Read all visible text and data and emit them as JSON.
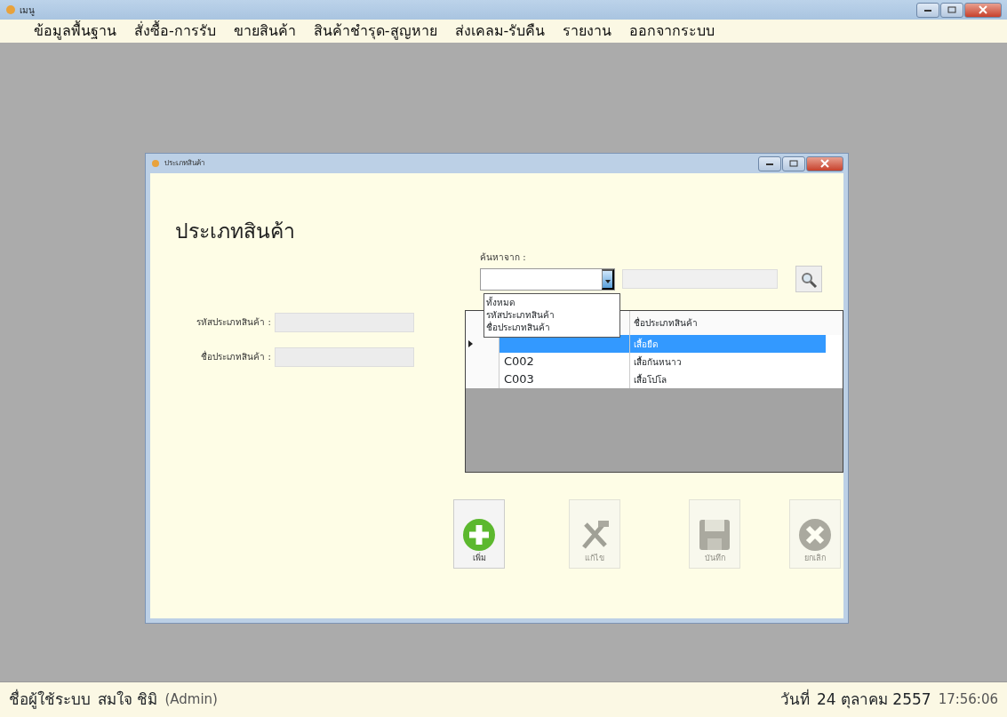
{
  "window": {
    "title": "เมนู"
  },
  "menu": [
    {
      "label": "ข้อมูลพื้นฐาน"
    },
    {
      "label": "สั่งซื้อ-การรับ"
    },
    {
      "label": "ขายสินค้า"
    },
    {
      "label": "สินค้าชำรุด-สูญหาย"
    },
    {
      "label": "ส่งเคลม-รับคืน"
    },
    {
      "label": "รายงาน"
    },
    {
      "label": "ออกจากระบบ"
    }
  ],
  "child_window": {
    "title": "ประเภทสินค้า",
    "heading": "ประเภทสินค้า",
    "fields": [
      {
        "label": "รหัสประเภทสินค้า :"
      },
      {
        "label": "ชื่อประเภทสินค้า :"
      }
    ],
    "search": {
      "label": "ค้นหาจาก :",
      "expanded": true,
      "options": [
        {
          "label": "ทั้งหมด"
        },
        {
          "label": "รหัสประเภทสินค้า"
        },
        {
          "label": "ชื่อประเภทสินค้า"
        }
      ]
    },
    "grid": {
      "column_2": "ชื่อประเภทสินค้า",
      "rows": [
        {
          "name": "เสื้อยืด",
          "selected": true
        },
        {
          "code": "C002",
          "name": "เสื้อกันหนาว",
          "selected": false
        },
        {
          "code": "C003",
          "name": "เสื้อโปโล",
          "selected": false
        }
      ]
    },
    "buttons": [
      {
        "label": "เพิ่ม",
        "kind": "add",
        "disabled": false
      },
      {
        "label": "แก้ไข",
        "kind": "edit",
        "disabled": true
      },
      {
        "label": "บันทึก",
        "kind": "save",
        "disabled": true
      },
      {
        "label": "ยกเลิก",
        "kind": "cancel",
        "disabled": true
      }
    ]
  },
  "status_bar": {
    "user_label": "ชื่อผู้ใช้ระบบ",
    "user_name": "สมใจ ชิมิ",
    "role": "(Admin)",
    "date_label": "วันที่",
    "date": "24 ตุลาคม 2557",
    "time": "17:56:06"
  }
}
